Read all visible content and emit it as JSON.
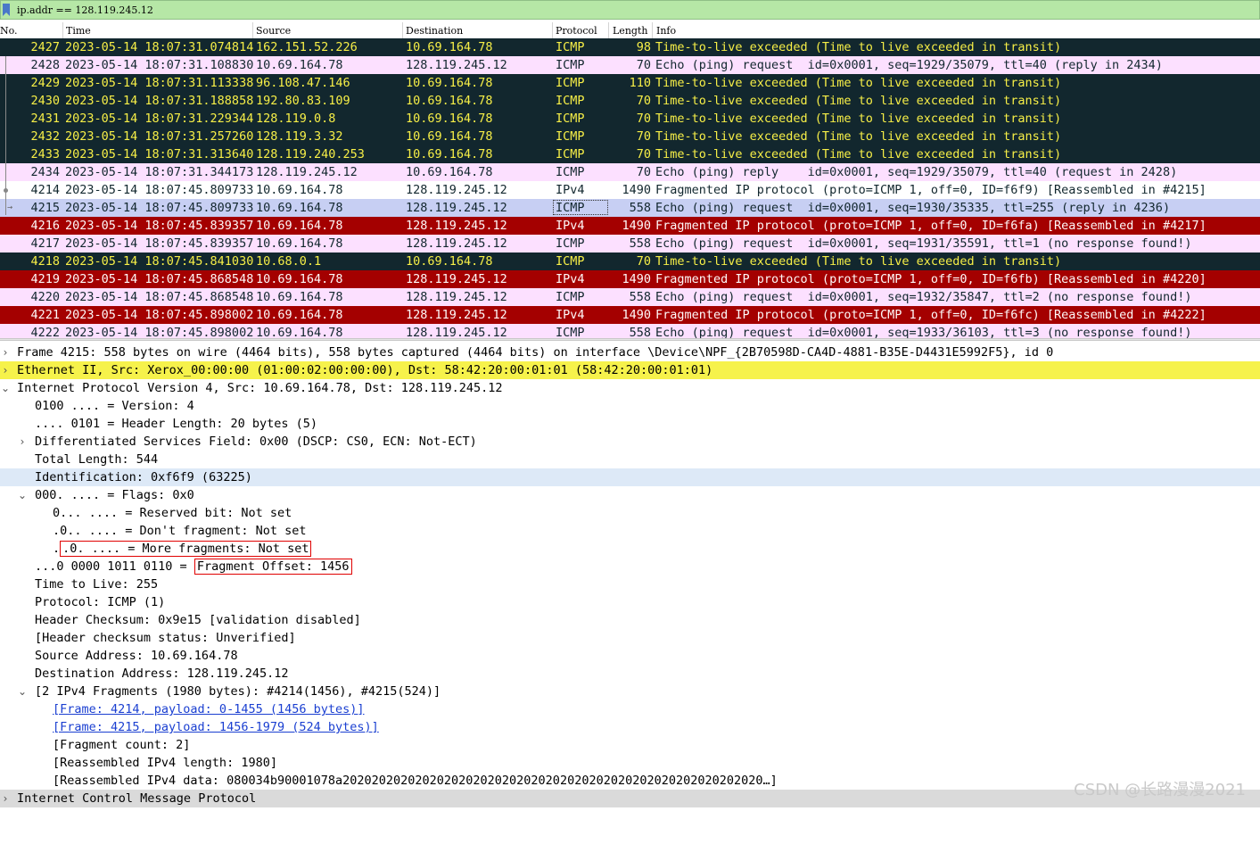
{
  "filter": {
    "text": "ip.addr == 128.119.245.12"
  },
  "columns": {
    "no": "No.",
    "time": "Time",
    "source": "Source",
    "destination": "Destination",
    "protocol": "Protocol",
    "length": "Length",
    "info": "Info"
  },
  "colors": {
    "ttl_bg": "#12272e",
    "ttl_fg": "#f7ef47",
    "echo_bg": "#fce0ff",
    "white_bg": "#ffffff",
    "selected_bg": "#c7cff3",
    "frag_bg": "#a40000",
    "frag_fg": "#fff9f9",
    "eth_bg": "#f6f24b",
    "ident_bg": "#dde9f7",
    "icmp_bg": "#dadada"
  },
  "packets": [
    {
      "no": "2427",
      "time": "2023-05-14 18:07:31.074814",
      "source": "162.151.52.226",
      "destination": "10.69.164.78",
      "protocol": "ICMP",
      "length": "98",
      "info": "Time-to-live exceeded (Time to live exceeded in transit)",
      "style": "ttl"
    },
    {
      "no": "2428",
      "time": "2023-05-14 18:07:31.108830",
      "source": "10.69.164.78",
      "destination": "128.119.245.12",
      "protocol": "ICMP",
      "length": "70",
      "info": "Echo (ping) request  id=0x0001, seq=1929/35079, ttl=40 (reply in 2434)",
      "style": "echo"
    },
    {
      "no": "2429",
      "time": "2023-05-14 18:07:31.113338",
      "source": "96.108.47.146",
      "destination": "10.69.164.78",
      "protocol": "ICMP",
      "length": "110",
      "info": "Time-to-live exceeded (Time to live exceeded in transit)",
      "style": "ttl"
    },
    {
      "no": "2430",
      "time": "2023-05-14 18:07:31.188858",
      "source": "192.80.83.109",
      "destination": "10.69.164.78",
      "protocol": "ICMP",
      "length": "70",
      "info": "Time-to-live exceeded (Time to live exceeded in transit)",
      "style": "ttl"
    },
    {
      "no": "2431",
      "time": "2023-05-14 18:07:31.229344",
      "source": "128.119.0.8",
      "destination": "10.69.164.78",
      "protocol": "ICMP",
      "length": "70",
      "info": "Time-to-live exceeded (Time to live exceeded in transit)",
      "style": "ttl"
    },
    {
      "no": "2432",
      "time": "2023-05-14 18:07:31.257260",
      "source": "128.119.3.32",
      "destination": "10.69.164.78",
      "protocol": "ICMP",
      "length": "70",
      "info": "Time-to-live exceeded (Time to live exceeded in transit)",
      "style": "ttl"
    },
    {
      "no": "2433",
      "time": "2023-05-14 18:07:31.313640",
      "source": "128.119.240.253",
      "destination": "10.69.164.78",
      "protocol": "ICMP",
      "length": "70",
      "info": "Time-to-live exceeded (Time to live exceeded in transit)",
      "style": "ttl"
    },
    {
      "no": "2434",
      "time": "2023-05-14 18:07:31.344173",
      "source": "128.119.245.12",
      "destination": "10.69.164.78",
      "protocol": "ICMP",
      "length": "70",
      "info": "Echo (ping) reply    id=0x0001, seq=1929/35079, ttl=40 (request in 2428)",
      "style": "echo"
    },
    {
      "no": "4214",
      "time": "2023-05-14 18:07:45.809733",
      "source": "10.69.164.78",
      "destination": "128.119.245.12",
      "protocol": "IPv4",
      "length": "1490",
      "info": "Fragmented IP protocol (proto=ICMP 1, off=0, ID=f6f9) [Reassembled in #4215]",
      "style": "white"
    },
    {
      "no": "4215",
      "time": "2023-05-14 18:07:45.809733",
      "source": "10.69.164.78",
      "destination": "128.119.245.12",
      "protocol": "ICMP",
      "length": "558",
      "info": "Echo (ping) request  id=0x0001, seq=1930/35335, ttl=255 (reply in 4236)",
      "style": "selected"
    },
    {
      "no": "4216",
      "time": "2023-05-14 18:07:45.839357",
      "source": "10.69.164.78",
      "destination": "128.119.245.12",
      "protocol": "IPv4",
      "length": "1490",
      "info": "Fragmented IP protocol (proto=ICMP 1, off=0, ID=f6fa) [Reassembled in #4217]",
      "style": "frag"
    },
    {
      "no": "4217",
      "time": "2023-05-14 18:07:45.839357",
      "source": "10.69.164.78",
      "destination": "128.119.245.12",
      "protocol": "ICMP",
      "length": "558",
      "info": "Echo (ping) request  id=0x0001, seq=1931/35591, ttl=1 (no response found!)",
      "style": "echo"
    },
    {
      "no": "4218",
      "time": "2023-05-14 18:07:45.841030",
      "source": "10.68.0.1",
      "destination": "10.69.164.78",
      "protocol": "ICMP",
      "length": "70",
      "info": "Time-to-live exceeded (Time to live exceeded in transit)",
      "style": "ttl"
    },
    {
      "no": "4219",
      "time": "2023-05-14 18:07:45.868548",
      "source": "10.69.164.78",
      "destination": "128.119.245.12",
      "protocol": "IPv4",
      "length": "1490",
      "info": "Fragmented IP protocol (proto=ICMP 1, off=0, ID=f6fb) [Reassembled in #4220]",
      "style": "frag"
    },
    {
      "no": "4220",
      "time": "2023-05-14 18:07:45.868548",
      "source": "10.69.164.78",
      "destination": "128.119.245.12",
      "protocol": "ICMP",
      "length": "558",
      "info": "Echo (ping) request  id=0x0001, seq=1932/35847, ttl=2 (no response found!)",
      "style": "echo"
    },
    {
      "no": "4221",
      "time": "2023-05-14 18:07:45.898002",
      "source": "10.69.164.78",
      "destination": "128.119.245.12",
      "protocol": "IPv4",
      "length": "1490",
      "info": "Fragmented IP protocol (proto=ICMP 1, off=0, ID=f6fc) [Reassembled in #4222]",
      "style": "frag"
    },
    {
      "no": "4222",
      "time": "2023-05-14 18:07:45.898002",
      "source": "10.69.164.78",
      "destination": "128.119.245.12",
      "protocol": "ICMP",
      "length": "558",
      "info": "Echo (ping) request  id=0x0001, seq=1933/36103, ttl=3 (no response found!)",
      "style": "echo"
    }
  ],
  "details": {
    "frame": "Frame 4215: 558 bytes on wire (4464 bits), 558 bytes captured (4464 bits) on interface \\Device\\NPF_{2B70598D-CA4D-4881-B35E-D4431E5992F5}, id 0",
    "ethernet": "Ethernet II, Src: Xerox_00:00:00 (01:00:02:00:00:00), Dst: 58:42:20:00:01:01 (58:42:20:00:01:01)",
    "ipv4": "Internet Protocol Version 4, Src: 10.69.164.78, Dst: 128.119.245.12",
    "version": "0100 .... = Version: 4",
    "header_length": ".... 0101 = Header Length: 20 bytes (5)",
    "dsfield": "Differentiated Services Field: 0x00 (DSCP: CS0, ECN: Not-ECT)",
    "total_length": "Total Length: 544",
    "identification": "Identification: 0xf6f9 (63225)",
    "flags": "000. .... = Flags: 0x0",
    "reserved_bit": "0... .... = Reserved bit: Not set",
    "dont_fragment": ".0.. .... = Don't fragment: Not set",
    "more_fragments_prefix": ".",
    "more_fragments": ".0. .... = More fragments: Not set",
    "frag_offset_prefix": "...0 0000 1011 0110 = ",
    "frag_offset": "Fragment Offset: 1456",
    "ttl": "Time to Live: 255",
    "protocol": "Protocol: ICMP (1)",
    "checksum": "Header Checksum: 0x9e15 [validation disabled]",
    "checksum_status": "[Header checksum status: Unverified]",
    "src_addr": "Source Address: 10.69.164.78",
    "dst_addr": "Destination Address: 128.119.245.12",
    "fragments": "[2 IPv4 Fragments (1980 bytes): #4214(1456), #4215(524)]",
    "frag1": "[Frame: 4214, payload: 0-1455 (1456 bytes)]",
    "frag2": "[Frame: 4215, payload: 1456-1979 (524 bytes)]",
    "frag_count": "[Fragment count: 2]",
    "reassembled_length": "[Reassembled IPv4 length: 1980]",
    "reassembled_data": "[Reassembled IPv4 data: 080034b90001078a2020202020202020202020202020202020202020202020202020202020…]",
    "icmp": "Internet Control Message Protocol"
  },
  "icons": {
    "collapsed": "chevron-right-icon",
    "expanded": "chevron-down-icon"
  },
  "watermark": "CSDN @长路漫漫2021"
}
